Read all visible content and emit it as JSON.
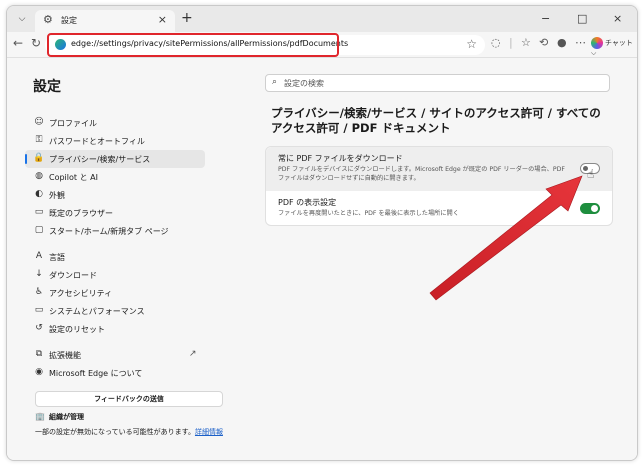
{
  "tab": {
    "title": "設定",
    "close": "×",
    "new": "+"
  },
  "window_controls": {
    "minimize": "−",
    "maximize": "□",
    "close": "×"
  },
  "address_bar": {
    "url": "edge://settings/privacy/sitePermissions/allPermissions/pdfDocuments"
  },
  "toolbar": {
    "chat_label": "チャット"
  },
  "settings": {
    "title": "設定",
    "search_placeholder": "設定の検索",
    "nav": [
      {
        "label": "プロファイル",
        "icon": "☺"
      },
      {
        "label": "パスワードとオートフィル",
        "icon": "⚿"
      },
      {
        "label": "プライバシー/検索/サービス",
        "icon": "🔒"
      },
      {
        "label": "Copilot と AI",
        "icon": "◍"
      },
      {
        "label": "外観",
        "icon": "◐"
      },
      {
        "label": "既定のブラウザー",
        "icon": "▭"
      },
      {
        "label": "スタート/ホーム/新規タブ ページ",
        "icon": "▢"
      },
      {
        "label": "言語",
        "icon": "A"
      },
      {
        "label": "ダウンロード",
        "icon": "↓"
      },
      {
        "label": "アクセシビリティ",
        "icon": "♿"
      },
      {
        "label": "システムとパフォーマンス",
        "icon": "▭"
      },
      {
        "label": "設定のリセット",
        "icon": "↺"
      },
      {
        "label": "拡張機能",
        "icon": "⧉"
      },
      {
        "label": "Microsoft Edge について",
        "icon": "◉"
      }
    ],
    "feedback_label": "フィードバックの送信",
    "org_managed": "組織が管理",
    "org_note": "一部の設定が無効になっている可能性があります。",
    "org_link": "詳細情報"
  },
  "page": {
    "heading": "プライバシー/検索/サービス / サイトのアクセス許可 / すべてのアクセス許可 / PDF ドキュメント",
    "rows": [
      {
        "title": "常に PDF ファイルをダウンロード",
        "desc": "PDF ファイルをデバイスにダウンロードします。Microsoft Edge が既定の PDF リーダーの場合、PDF ファイルはダウンロードせずに自動的に開きます。",
        "enabled": false
      },
      {
        "title": "PDF の表示設定",
        "desc": "ファイルを再度開いたときに、PDF を最後に表示した場所に開く",
        "enabled": true
      }
    ]
  },
  "colors": {
    "highlight": "#e0262c",
    "toggle_on": "#1e8e3e",
    "accent": "#1a73e8",
    "arrow": "#d9232a"
  }
}
